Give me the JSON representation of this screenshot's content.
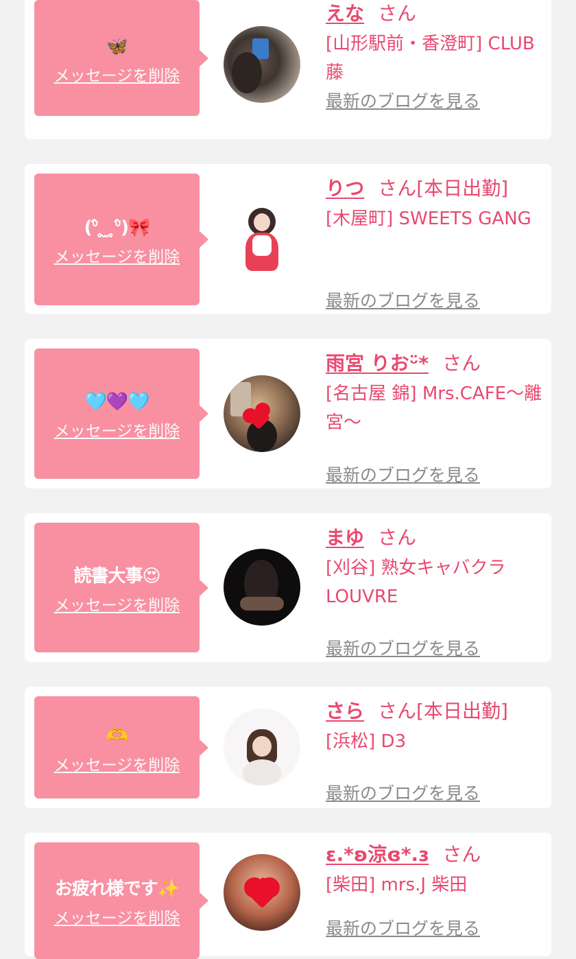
{
  "delete_label": "メッセージを削除",
  "blog_label": "最新のブログを見る",
  "honorific": "さん",
  "colors": {
    "background": "#f2f2f2",
    "bubble": "#f890a2",
    "name": "#e8486f",
    "blog_link": "#8a8a8a"
  },
  "cards": [
    {
      "message": "🦋",
      "name": "えな",
      "shift": "",
      "shop": "[山形駅前・香澄町] CLUB 藤",
      "avatar_icon": "selfie-photo-icon"
    },
    {
      "message": "(ᐡ̂ ̥ ̫ ̥ᐡ̂)🎀",
      "name": "りつ",
      "shift": "[本日出勤]",
      "shop": "[木屋町] SWEETS GANG",
      "avatar_icon": "maid-photo-icon"
    },
    {
      "message": "🩵💜🩵",
      "name": "雨宮 りおᵕ̈*",
      "shift": "",
      "shop": "[名古屋 錦] Mrs.CAFE～離宮～",
      "avatar_icon": "heart-covered-photo-icon"
    },
    {
      "message": "読書大事😍",
      "name": "まゆ",
      "shift": "",
      "shop": "[刈谷] 熟女キャバクラ LOUVRE",
      "avatar_icon": "dark-photo-icon"
    },
    {
      "message": "🫶",
      "name": "さら",
      "shift": "[本日出勤]",
      "shop": "[浜松] D3",
      "avatar_icon": "portrait-photo-icon"
    },
    {
      "message": "お疲れ様です✨",
      "name": "ɛ.*ʚ涼ɞ*.ɜ",
      "shift": "",
      "shop": "[柴田] mrs.J 柴田",
      "avatar_icon": "heart-covered-photo-icon"
    }
  ]
}
